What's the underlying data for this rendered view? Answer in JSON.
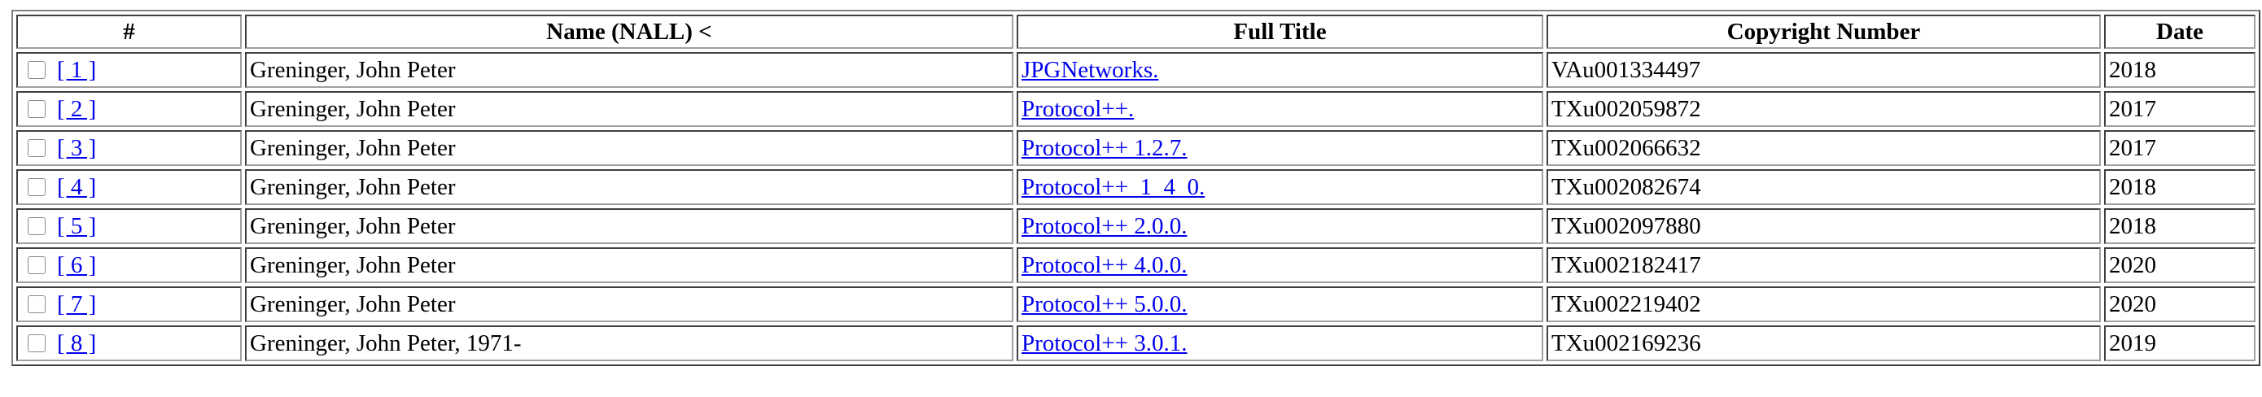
{
  "table": {
    "headers": {
      "num": "#",
      "name": "Name (NALL) <",
      "title": "Full Title",
      "copyright": "Copyright Number",
      "date": "Date"
    },
    "rows": [
      {
        "num": "[ 1 ]",
        "name": "Greninger, John Peter",
        "title": "JPGNetworks.",
        "copyright": "VAu001334497",
        "date": "2018"
      },
      {
        "num": "[ 2 ]",
        "name": "Greninger, John Peter",
        "title": "Protocol++.",
        "copyright": "TXu002059872",
        "date": "2017"
      },
      {
        "num": "[ 3 ]",
        "name": "Greninger, John Peter",
        "title": "Protocol++ 1.2.7.",
        "copyright": "TXu002066632",
        "date": "2017"
      },
      {
        "num": "[ 4 ]",
        "name": "Greninger, John Peter",
        "title": "Protocol++_1_4_0.",
        "copyright": "TXu002082674",
        "date": "2018"
      },
      {
        "num": "[ 5 ]",
        "name": "Greninger, John Peter",
        "title": "Protocol++ 2.0.0.",
        "copyright": "TXu002097880",
        "date": "2018"
      },
      {
        "num": "[ 6 ]",
        "name": "Greninger, John Peter",
        "title": "Protocol++ 4.0.0.",
        "copyright": "TXu002182417",
        "date": "2020"
      },
      {
        "num": "[ 7 ]",
        "name": "Greninger, John Peter",
        "title": "Protocol++ 5.0.0.",
        "copyright": "TXu002219402",
        "date": "2020"
      },
      {
        "num": "[ 8 ]",
        "name": "Greninger, John Peter, 1971-",
        "title": "Protocol++ 3.0.1.",
        "copyright": "TXu002169236",
        "date": "2019"
      }
    ]
  },
  "colors": {
    "link": "#0000ee",
    "border_dark": "#404040",
    "border_light": "#a0a0a0"
  }
}
